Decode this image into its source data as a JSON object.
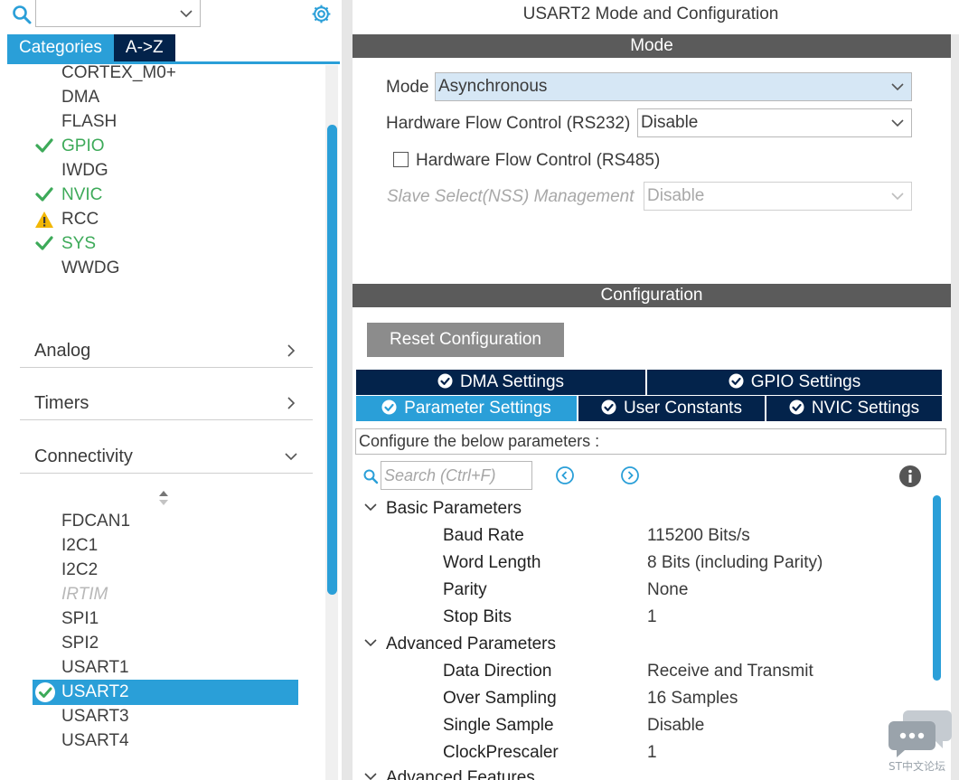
{
  "left": {
    "search": {
      "value": ""
    },
    "category_tabs": [
      {
        "label": "Categories",
        "active": true
      },
      {
        "label": "A->Z",
        "active": false
      }
    ],
    "system_items": [
      {
        "label": "CORTEX_M0+",
        "status": "none"
      },
      {
        "label": "DMA",
        "status": "none"
      },
      {
        "label": "FLASH",
        "status": "none"
      },
      {
        "label": "GPIO",
        "status": "ok"
      },
      {
        "label": "IWDG",
        "status": "none"
      },
      {
        "label": "NVIC",
        "status": "ok"
      },
      {
        "label": "RCC",
        "status": "warning"
      },
      {
        "label": "SYS",
        "status": "ok"
      },
      {
        "label": "WWDG",
        "status": "none"
      }
    ],
    "sections": [
      {
        "label": "Analog",
        "expanded": false
      },
      {
        "label": "Timers",
        "expanded": false
      },
      {
        "label": "Connectivity",
        "expanded": true
      }
    ],
    "connectivity_items": [
      {
        "label": "FDCAN1",
        "status": "none"
      },
      {
        "label": "I2C1",
        "status": "none"
      },
      {
        "label": "I2C2",
        "status": "none"
      },
      {
        "label": "IRTIM",
        "status": "disabled"
      },
      {
        "label": "SPI1",
        "status": "none"
      },
      {
        "label": "SPI2",
        "status": "none"
      },
      {
        "label": "USART1",
        "status": "none"
      },
      {
        "label": "USART2",
        "status": "selected"
      },
      {
        "label": "USART3",
        "status": "none"
      },
      {
        "label": "USART4",
        "status": "none"
      }
    ]
  },
  "right": {
    "title": "USART2 Mode and Configuration",
    "mode_header": "Mode",
    "mode": {
      "mode_label": "Mode",
      "mode_value": "Asynchronous",
      "hfc232_label": "Hardware Flow Control (RS232)",
      "hfc232_value": "Disable",
      "hfc485_label": "Hardware Flow Control (RS485)",
      "hfc485_checked": false,
      "nss_label": "Slave Select(NSS) Management",
      "nss_value": "Disable"
    },
    "config_header": "Configuration",
    "reset_label": "Reset Configuration",
    "tabs_row1": [
      {
        "label": "DMA Settings",
        "active": false
      },
      {
        "label": "GPIO Settings",
        "active": false
      }
    ],
    "tabs_row2": [
      {
        "label": "Parameter Settings",
        "active": true
      },
      {
        "label": "User Constants",
        "active": false
      },
      {
        "label": "NVIC Settings",
        "active": false
      }
    ],
    "config_hint": "Configure the below parameters :",
    "param_search_placeholder": "Search (Ctrl+F)",
    "groups": [
      {
        "name": "Basic Parameters",
        "params": [
          {
            "name": "Baud Rate",
            "value": "115200 Bits/s"
          },
          {
            "name": "Word Length",
            "value": "8 Bits (including Parity)"
          },
          {
            "name": "Parity",
            "value": "None"
          },
          {
            "name": "Stop Bits",
            "value": "1"
          }
        ]
      },
      {
        "name": "Advanced Parameters",
        "params": [
          {
            "name": "Data Direction",
            "value": "Receive and Transmit"
          },
          {
            "name": "Over Sampling",
            "value": "16 Samples"
          },
          {
            "name": "Single Sample",
            "value": "Disable"
          },
          {
            "name": "ClockPrescaler",
            "value": "1"
          }
        ]
      },
      {
        "name": "Advanced Features",
        "params": []
      }
    ]
  },
  "watermark": {
    "text": "ST中文论坛"
  },
  "colors": {
    "accent": "#2a9fd8",
    "navy": "#03234b",
    "header_gray": "#5b5b5b",
    "ok_green": "#3daa59",
    "warning_yellow": "#f2b705"
  },
  "icons": {
    "search": "search-icon",
    "settings": "gear-icon",
    "ok": "check-icon",
    "warning": "warning-icon",
    "dropdown": "chevron-down-icon",
    "info": "info-icon"
  }
}
